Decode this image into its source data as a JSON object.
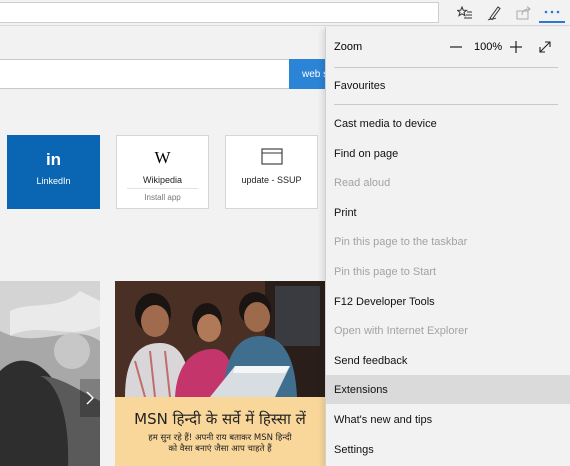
{
  "browser": {
    "address_value": "",
    "toolbar_icons": [
      "favorites-hub-icon",
      "web-note-icon",
      "share-icon",
      "more-icon"
    ],
    "accent_color": "#2b78d4"
  },
  "page": {
    "search_button_label": "web s",
    "tiles": [
      {
        "label": "LinkedIn",
        "logo": "in"
      },
      {
        "label": "Wikipedia",
        "logo": "W",
        "sub": "Install app"
      },
      {
        "label": "update - SSUP",
        "logo": "window-icon"
      }
    ],
    "news_banner": {
      "title": "MSN हिन्दी के सर्वे में हिस्सा लें",
      "subtitle_line1": "हम सुन रहे हैं! अपनी राय बताकर MSN हिन्दी",
      "subtitle_line2": "को वैसा बनाएं जैसा आप चाहते हैं"
    }
  },
  "menu": {
    "zoom_label": "Zoom",
    "zoom_value": "100%",
    "items": [
      {
        "label": "Favourites",
        "disabled": false
      },
      {
        "label": "Cast media to device",
        "disabled": false
      },
      {
        "label": "Find on page",
        "disabled": false
      },
      {
        "label": "Read aloud",
        "disabled": true
      },
      {
        "label": "Print",
        "disabled": false
      },
      {
        "label": "Pin this page to the taskbar",
        "disabled": true
      },
      {
        "label": "Pin this page to Start",
        "disabled": true
      },
      {
        "label": "F12 Developer Tools",
        "disabled": false
      },
      {
        "label": "Open with Internet Explorer",
        "disabled": true
      },
      {
        "label": "Send feedback",
        "disabled": false
      },
      {
        "label": "Extensions",
        "disabled": false,
        "highlighted": true
      },
      {
        "label": "What's new and tips",
        "disabled": false
      },
      {
        "label": "Settings",
        "disabled": false
      }
    ]
  }
}
